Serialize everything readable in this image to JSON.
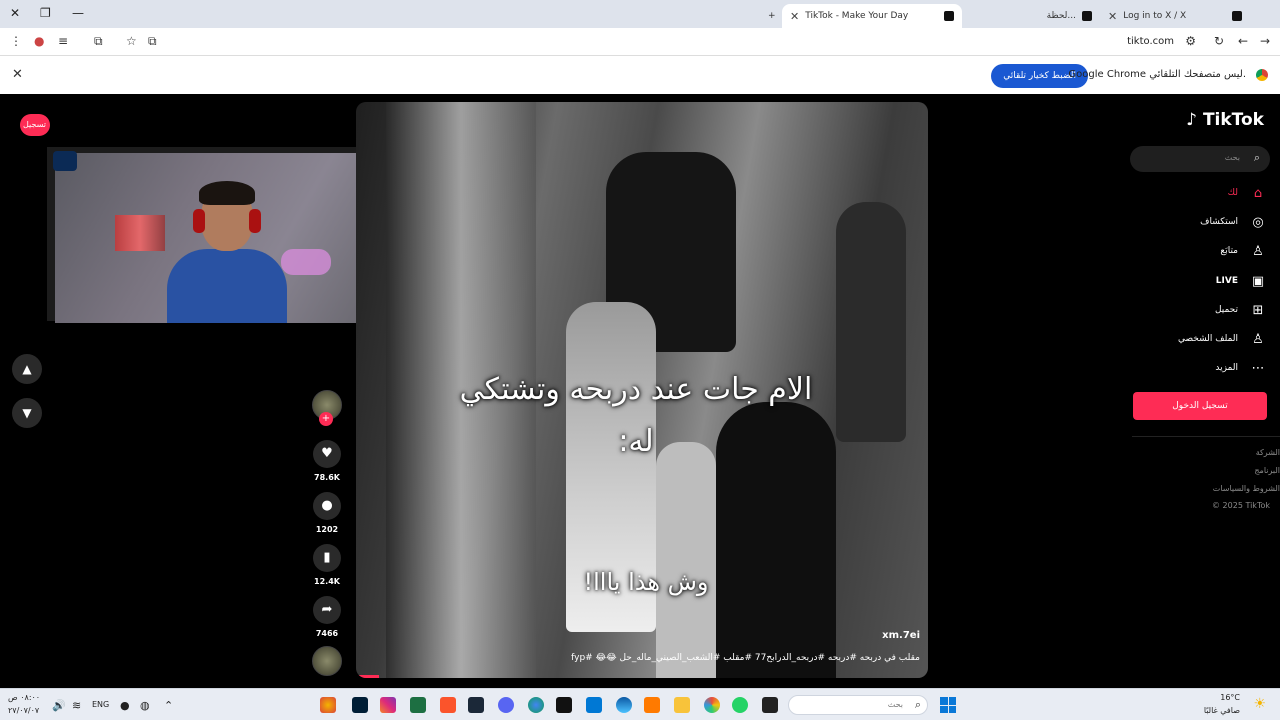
{
  "browser": {
    "tabs": [
      {
        "label": "Log in to X / X"
      },
      {
        "label": "لحظة..."
      },
      {
        "label": "TikTok - Make Your Day"
      }
    ],
    "new_tab": "+",
    "url": "tikto.com",
    "infobar": {
      "message": "Google Chrome ليس متصفحك التلقائي.",
      "button": "الضبط كخيار تلقائي",
      "close": "✕"
    }
  },
  "webcam": {},
  "tiktok": {
    "login_pill": "تسجيل الدخول",
    "logo": "♪ TikTok",
    "search_placeholder": "بحث",
    "nav": [
      {
        "label": "لك",
        "icon": "home-icon"
      },
      {
        "label": "استكشاف",
        "icon": "compass-icon"
      },
      {
        "label": "متابَع",
        "icon": "following-icon"
      },
      {
        "label": "LIVE",
        "icon": "live-icon"
      },
      {
        "label": "تحميل",
        "icon": "upload-icon"
      },
      {
        "label": "الملف الشخصي",
        "icon": "profile-icon"
      },
      {
        "label": "المزيد",
        "icon": "more-icon"
      }
    ],
    "login_button": "تسجيل الدخول",
    "footer": [
      "الشركة",
      "البرنامج",
      "الشروط والسياسات",
      "© 2025 TikTok"
    ],
    "video": {
      "overlay_line1": "الام جات عند دربحه وتشتكي",
      "overlay_line2": "له:",
      "overlay_bottom": "وش هذا يااا!",
      "author": "xm.7ei",
      "caption": "مقلب في دربحه #دربحه #دربحه_الدرابح77 #مقلب #الشعب_الصيني_ماله_حل 😂😂 #fyp",
      "progress_fraction": 0.04
    },
    "actions": {
      "likes": "78.6K",
      "comments": "1202",
      "saves": "12.4K",
      "shares": "7466"
    }
  },
  "taskbar": {
    "search_placeholder": "بحث",
    "lang": "ENG",
    "time": "٠٨:٠٠ ص",
    "date": "٢٧/٠٧/٠٧",
    "weather_temp": "16°C",
    "weather_desc": "صافي غالبًا"
  },
  "colors": {
    "accent": "#fe2c55",
    "chrome_button": "#1a58d2"
  }
}
